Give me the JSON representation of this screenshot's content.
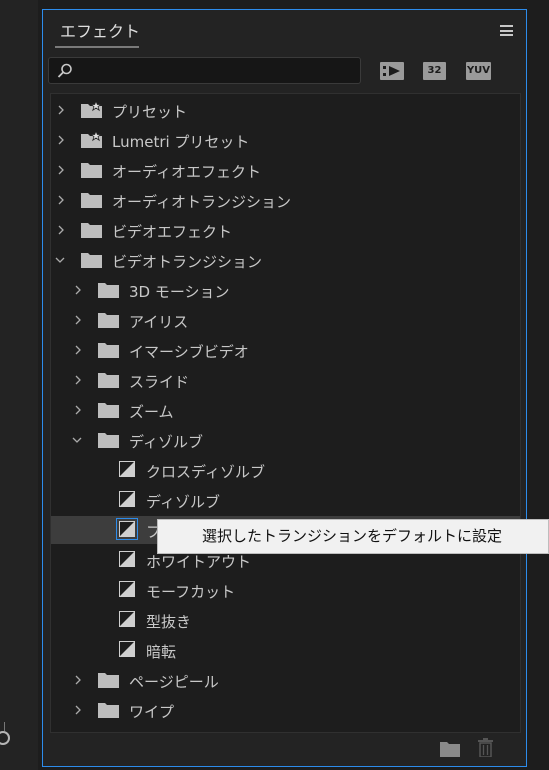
{
  "panel": {
    "title": "エフェクト"
  },
  "toolbar": {
    "icons": [
      {
        "name": "accelerated-effects-icon",
        "label": ""
      },
      {
        "name": "32bit-icon",
        "label": "32"
      },
      {
        "name": "yuv-icon",
        "label": "YUV"
      }
    ]
  },
  "tree": {
    "top": [
      {
        "label": "プリセット",
        "icon": "preset-folder-icon",
        "expanded": false
      },
      {
        "label": "Lumetri プリセット",
        "icon": "preset-folder-icon",
        "expanded": false
      },
      {
        "label": "オーディオエフェクト",
        "icon": "folder-icon",
        "expanded": false
      },
      {
        "label": "オーディオトランジション",
        "icon": "folder-icon",
        "expanded": false
      },
      {
        "label": "ビデオエフェクト",
        "icon": "folder-icon",
        "expanded": false
      },
      {
        "label": "ビデオトランジション",
        "icon": "folder-icon",
        "expanded": true
      }
    ],
    "video_transitions": [
      {
        "label": "3D モーション",
        "expanded": false
      },
      {
        "label": "アイリス",
        "expanded": false
      },
      {
        "label": "イマーシブビデオ",
        "expanded": false
      },
      {
        "label": "スライド",
        "expanded": false
      },
      {
        "label": "ズーム",
        "expanded": false
      },
      {
        "label": "ディゾルブ",
        "expanded": true
      },
      {
        "label": "ページピール",
        "expanded": false
      },
      {
        "label": "ワイプ",
        "expanded": false
      }
    ],
    "dissolve_items": [
      {
        "label": "クロスディゾルブ"
      },
      {
        "label": "ディゾルブ"
      },
      {
        "label": "フ"
      },
      {
        "label": "ホワイトアウト"
      },
      {
        "label": "モーフカット"
      },
      {
        "label": "型抜き"
      },
      {
        "label": "暗転"
      }
    ]
  },
  "tooltip": {
    "text": "選択したトランジションをデフォルトに設定"
  }
}
